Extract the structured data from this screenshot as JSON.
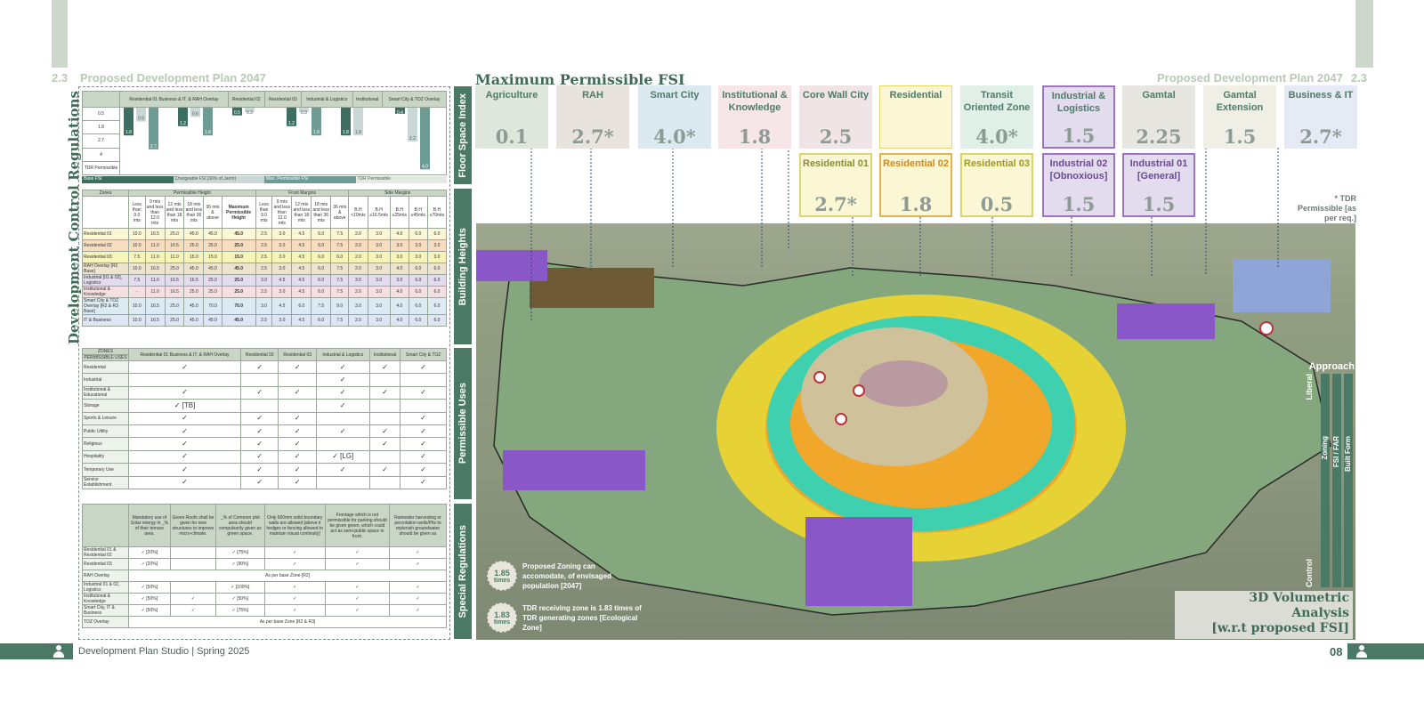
{
  "header": {
    "left_num": "2.3",
    "left_title": "Proposed Development Plan 2047",
    "right_title": "Proposed Development Plan 2047",
    "right_num": "2.3"
  },
  "main_title": "Maximum Permissible FSI",
  "side_title": "Development Control Regulations",
  "section_labels": [
    "Floor Space Index",
    "Building Heights",
    "Permissible Uses",
    "Special Regulations"
  ],
  "fsi_tiles": [
    {
      "name": "Agriculture",
      "value": "0.1",
      "bg": "#dfe6dc"
    },
    {
      "name": "RAH",
      "value": "2.7*",
      "bg": "#e8e3dc"
    },
    {
      "name": "Smart City",
      "value": "4.0*",
      "bg": "#dde9f0"
    },
    {
      "name": "Institutional & Knowledge",
      "value": "1.8",
      "bg": "#f6e6e8"
    },
    {
      "name": "Core Wall City",
      "value": "2.5",
      "bg": "#f1e4e6"
    },
    {
      "name": "Residential",
      "value": "",
      "bg": "#fbf6d3"
    },
    {
      "name": "Transit Oriented Zone",
      "value": "4.0*",
      "bg": "#e0efe8"
    },
    {
      "name": "Industrial & Logistics",
      "value": "1.5",
      "bg": "#e3dbee"
    },
    {
      "name": "Gamtal",
      "value": "2.25",
      "bg": "#e8e6e1"
    },
    {
      "name": "Gamtal Extension",
      "value": "1.5",
      "bg": "#f0efe6"
    },
    {
      "name": "Business & IT",
      "value": "2.7*",
      "bg": "#e6eaf4"
    }
  ],
  "sub_tiles": [
    {
      "name": "Residential 01",
      "value": "2.7*",
      "bg": "#fbf6d3",
      "border": "#e1d374",
      "color": "#8c8b36"
    },
    {
      "name": "Residential 02",
      "value": "1.8",
      "bg": "#fbf6d3",
      "border": "#e3b24e",
      "color": "#d28a1c"
    },
    {
      "name": "Residential 03",
      "value": "0.5",
      "bg": "#fbf6d3",
      "border": "#d9d46a",
      "color": "#9a9a1f"
    },
    {
      "name": "Industrial 02 [Obnoxious]",
      "value": "1.5",
      "bg": "#e3dbee",
      "border": "#9f73c2",
      "color": "#6b4b93"
    },
    {
      "name": "Industrial 01 [General]",
      "value": "1.5",
      "bg": "#e3dbee",
      "border": "#9f73c2",
      "color": "#6b4b93"
    }
  ],
  "tdr_note": "* TDR Permissible [as per req.]",
  "approach": {
    "title": "Approach",
    "top": "Liberal",
    "bottom": "Control",
    "bars": [
      "Zoning",
      "FSI / FAR",
      "Built Form"
    ]
  },
  "badges": [
    {
      "value": "1.85",
      "unit": "times",
      "text": "Proposed Zoning can accomodate, of envisaged population [2047]"
    },
    {
      "value": "1.83",
      "unit": "times",
      "text": "TDR receiving zone is 1.83 times of TDR generating zones [Ecological Zone]"
    }
  ],
  "analysis_title": [
    "3D Volumetric",
    "Analysis",
    "[w.r.t proposed FSI]"
  ],
  "footer": {
    "text": "Development Plan Studio | Spring 2025",
    "page": "08"
  },
  "fsi_chart": {
    "zones": [
      "Residential 01 Business & IT, & RAH Overlay",
      "Residential 02",
      "Residential 03",
      "Industrial & Logistics",
      "Institutional",
      "Smart City & TOZ Overlay"
    ],
    "rows": [
      "0.5",
      "1.8",
      "2.7",
      "4",
      "TDR Permissible"
    ],
    "legend": [
      "Base FSI",
      "Chargeable FSI [30% of Jantri]",
      "Max. Permissible FSI",
      "TDR Permissible"
    ],
    "values": [
      "1.8",
      "0.9",
      "2.7",
      "1.2",
      "0.6",
      "1.8",
      "0.5",
      "0.3",
      "1.2",
      "0.3",
      "1.8",
      "1.8",
      "1.8",
      "0.4",
      "2.2",
      "4.0"
    ]
  },
  "heights": {
    "groups": [
      "Zones",
      "Permissible Height",
      "Front Margins",
      "Side Margins"
    ],
    "cols": [
      "Less than 9.0 mts",
      "9 mts and less than 12.0 mts",
      "12 mts and less than 18 mts",
      "18 mts and less than 36 mts",
      "36 mts & above",
      "Maximum Permissible Height",
      "Less than 9.0 mts",
      "9 mts and less than 12.0 mts",
      "12 mts and less than 18 mts",
      "18 mts and less than 36 mts",
      "36 mts & above",
      "B.H <10mts",
      "B.H ≥16.5mts",
      "B.H ≤25mts",
      "B.H ≤45mts",
      "B.H ≤70mts"
    ],
    "rows": [
      {
        "z": "Residential 01",
        "c": "#fbf6d3",
        "v": [
          "10.0",
          "16.5",
          "25.0",
          "45.0",
          "45.0",
          "45.0",
          "2.5",
          "3.0",
          "4.5",
          "6.0",
          "7.5",
          "2.0",
          "3.0",
          "4.0",
          "6.0",
          "6.0"
        ]
      },
      {
        "z": "Residential 02",
        "c": "#f7dcbf",
        "v": [
          "10.0",
          "11.0",
          "16.5",
          "25.0",
          "25.0",
          "25.0",
          "2.5",
          "3.0",
          "4.5",
          "6.0",
          "7.5",
          "2.0",
          "3.0",
          "3.0",
          "3.0",
          "3.0"
        ]
      },
      {
        "z": "Residential 03",
        "c": "#f7f4b7",
        "v": [
          "7.5",
          "11.0",
          "11.0",
          "15.0",
          "15.0",
          "15.0",
          "2.5",
          "3.0",
          "4.5",
          "6.0",
          "6.0",
          "2.0",
          "3.0",
          "3.0",
          "3.0",
          "3.0"
        ]
      },
      {
        "z": "RAH Overlay [R2 Base]",
        "c": "#eee3cf",
        "v": [
          "10.0",
          "16.5",
          "25.0",
          "45.0",
          "45.0",
          "45.0",
          "2.5",
          "3.0",
          "4.5",
          "6.0",
          "7.5",
          "2.0",
          "3.0",
          "4.0",
          "6.0",
          "6.0"
        ]
      },
      {
        "z": "Industrial [01 & 02], Logistics",
        "c": "#e3dbee",
        "v": [
          "7.5",
          "11.0",
          "16.5",
          "16.5",
          "25.0",
          "25.0",
          "3.0",
          "4.5",
          "4.5",
          "6.0",
          "7.5",
          "3.0",
          "3.0",
          "3.0",
          "6.0",
          "6.0"
        ]
      },
      {
        "z": "Institutional & Knowledge",
        "c": "#f6dfe3",
        "v": [
          "-",
          "11.0",
          "16.5",
          "25.0",
          "25.0",
          "25.0",
          "2.5",
          "3.0",
          "4.5",
          "6.0",
          "7.5",
          "2.0",
          "3.0",
          "4.0",
          "6.0",
          "6.0"
        ]
      },
      {
        "z": "Smart City & TOZ Overlay [R2 & R3 Base]",
        "c": "#dcebf3",
        "v": [
          "10.0",
          "16.5",
          "25.0",
          "45.0",
          "70.0",
          "70.0",
          "3.0",
          "4.5",
          "6.0",
          "7.5",
          "9.0",
          "3.0",
          "3.0",
          "4.0",
          "6.0",
          "6.0"
        ]
      },
      {
        "z": "IT & Business",
        "c": "#dfe6f3",
        "v": [
          "10.0",
          "16.5",
          "25.0",
          "45.0",
          "45.0",
          "45.0",
          "2.5",
          "3.0",
          "4.5",
          "6.0",
          "7.5",
          "2.0",
          "3.0",
          "4.0",
          "6.0",
          "6.0"
        ]
      }
    ]
  },
  "uses": {
    "zones_label": "ZONES",
    "uses_label": "PERMISSIBLE USES",
    "cols": [
      "Residential 01 Business & IT, & RAH Overlay",
      "Residential 02",
      "Residential 03",
      "Industrial & Logistics",
      "Institutional",
      "Smart City & TOZ"
    ],
    "rows": [
      {
        "u": "Residential",
        "v": [
          "✓",
          "✓",
          "✓",
          "✓",
          "✓",
          "✓"
        ]
      },
      {
        "u": "Industrial",
        "v": [
          "",
          "",
          "",
          "✓",
          "",
          ""
        ]
      },
      {
        "u": "Institutional & Educational",
        "v": [
          "✓",
          "✓",
          "✓",
          "✓",
          "✓",
          "✓"
        ]
      },
      {
        "u": "Storage",
        "v": [
          "✓ [TB]",
          "",
          "",
          "✓",
          "",
          ""
        ]
      },
      {
        "u": "Sports & Leisure",
        "v": [
          "✓",
          "✓",
          "✓",
          "",
          "",
          "✓"
        ]
      },
      {
        "u": "Public Utility",
        "v": [
          "✓",
          "✓",
          "✓",
          "✓",
          "✓",
          "✓"
        ]
      },
      {
        "u": "Religious",
        "v": [
          "✓",
          "✓",
          "✓",
          "",
          "✓",
          "✓"
        ]
      },
      {
        "u": "Hospitality",
        "v": [
          "✓",
          "✓",
          "✓",
          "✓ [LG]",
          "",
          "✓"
        ]
      },
      {
        "u": "Temporary Use",
        "v": [
          "✓",
          "✓",
          "✓",
          "✓",
          "✓",
          "✓"
        ]
      },
      {
        "u": "Service Establishment",
        "v": [
          "✓",
          "✓",
          "✓",
          "",
          "",
          "✓"
        ]
      }
    ]
  },
  "special": {
    "cols": [
      "Mandatory use of Solar energy in _% of their terrace area.",
      "Green Roofs shall be given for new structures to improve micro-climate.",
      "_% of Common plot area should compulsorily given as green space.",
      "Only 600mm solid boundary walls are allowed [above it hedges or fencing allowed to maintain visual continuity]",
      "Frontage which is not permissible for parking should be given green, which could act as semi-public space in front.",
      "Rainwater harvesting or percolation wells/Pits to replenish groundwater should be given as"
    ],
    "rows": [
      {
        "z": "Residential 01 & Residential 02",
        "v": [
          "✓ [20%]",
          "",
          "✓ [75%]",
          "✓",
          "✓",
          "✓"
        ]
      },
      {
        "z": "Residential 03",
        "v": [
          "✓ [20%]",
          "",
          "✓ [90%]",
          "✓",
          "✓",
          "✓"
        ]
      },
      {
        "z": "RAH Overlay",
        "span": "As per base Zone [R2]"
      },
      {
        "z": "Industrial 01 & 02, Logistics",
        "v": [
          "✓ [50%]",
          "",
          "✓ [100%]",
          "✓",
          "✓",
          "✓"
        ]
      },
      {
        "z": "Institutional & Knowledge",
        "v": [
          "✓ [50%]",
          "✓",
          "✓ [50%]",
          "✓",
          "✓",
          "✓"
        ]
      },
      {
        "z": "Smart City, IT & Business",
        "v": [
          "✓ [50%]",
          "✓",
          "✓ [75%]",
          "✓",
          "✓",
          "✓"
        ]
      },
      {
        "z": "TOZ Overlay",
        "span": "As per base Zone [R2 & R3]"
      }
    ]
  },
  "colors": {
    "accent": "#4a7a66",
    "title": "#3f6b58",
    "light": "#b8c9b4"
  }
}
